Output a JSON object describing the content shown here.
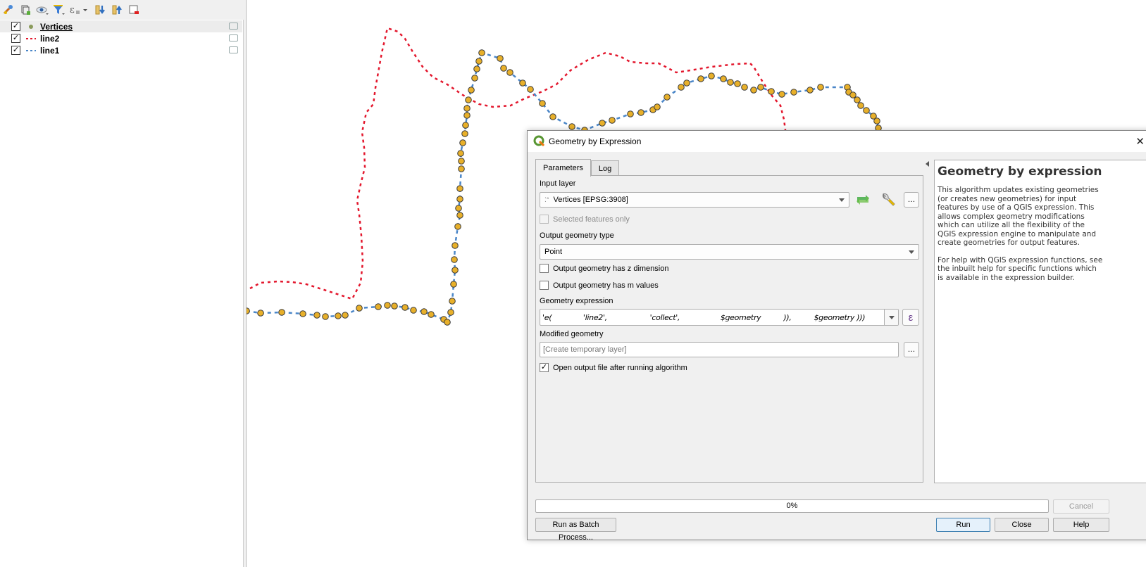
{
  "layers_panel": {
    "toolbar_icons": [
      {
        "name": "style-manager-icon"
      },
      {
        "name": "add-group-icon"
      },
      {
        "name": "manage-map-themes-icon"
      },
      {
        "name": "filter-legend-icon"
      },
      {
        "name": "filter-by-expression-icon"
      },
      {
        "name": "expand-all-icon"
      },
      {
        "name": "collapse-all-icon"
      },
      {
        "name": "remove-layer-icon"
      }
    ],
    "layers": [
      {
        "name": "Vertices",
        "checked": true,
        "active": true,
        "symbol": "point",
        "color": "#8a9a5b"
      },
      {
        "name": "line2",
        "checked": true,
        "active": false,
        "symbol": "dashed-line",
        "color": "#e3172d"
      },
      {
        "name": "line1",
        "checked": true,
        "active": false,
        "symbol": "dashed-line",
        "color": "#4a86c8"
      }
    ]
  },
  "map": {
    "line2_color": "#e3172d",
    "line1_color": "#4a86c8",
    "vertex_fill": "#e8b02a",
    "vertex_stroke": "#3a3a3a"
  },
  "dialog": {
    "title": "Geometry by Expression",
    "close_glyph": "✕",
    "tabs": [
      {
        "label": "Parameters",
        "active": true
      },
      {
        "label": "Log",
        "active": false
      }
    ],
    "input_layer": {
      "label": "Input layer",
      "value": "Vertices [EPSG:3908]",
      "more_label": "…"
    },
    "selected_only": {
      "label": "Selected features only",
      "checked": false,
      "enabled": false
    },
    "output_geometry_type": {
      "label": "Output geometry type",
      "value": "Point"
    },
    "has_z": {
      "label": "Output geometry has z dimension",
      "checked": false
    },
    "has_m": {
      "label": "Output geometry has m values",
      "checked": false
    },
    "geometry_expression": {
      "label": "Geometry expression",
      "value": "'e(              'line2',                   'collect',                  $geometry          )),          $geometry )))",
      "expression_button": "ε"
    },
    "modified_geometry": {
      "label": "Modified geometry",
      "placeholder": "[Create temporary layer]",
      "more_label": "…"
    },
    "open_output": {
      "label": "Open output file after running algorithm",
      "checked": true
    },
    "help": {
      "title": "Geometry by expression",
      "paragraphs": [
        "This algorithm updates existing geometries (or creates new geometries) for input features by use of a QGIS expression. This allows complex geometry modifications which can utilize all the flexibility of the QGIS expression engine to manipulate and create geometries for output features.",
        "For help with QGIS expression functions, see the inbuilt help for specific functions which is available in the expression builder."
      ]
    },
    "progress": {
      "value": 0,
      "text": "0%"
    },
    "buttons": {
      "cancel": "Cancel",
      "batch": "Run as Batch Process...",
      "run": "Run",
      "close": "Close",
      "help": "Help"
    }
  }
}
